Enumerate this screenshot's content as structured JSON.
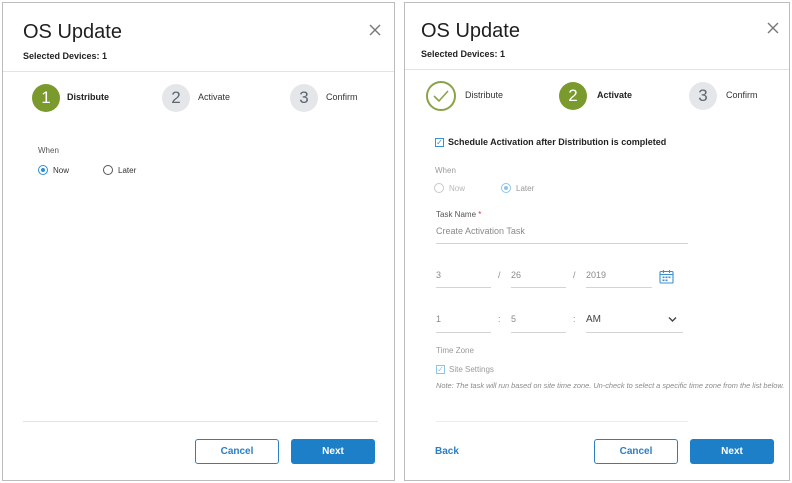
{
  "left_panel": {
    "title": "OS Update",
    "subtitle": "Selected Devices: 1",
    "steps": [
      {
        "number": "1",
        "label": "Distribute",
        "state": "active"
      },
      {
        "number": "2",
        "label": "Activate",
        "state": "inactive"
      },
      {
        "number": "3",
        "label": "Confirm",
        "state": "inactive"
      }
    ],
    "when_label": "When",
    "when_options": [
      {
        "label": "Now",
        "selected": true
      },
      {
        "label": "Later",
        "selected": false
      }
    ],
    "cancel_label": "Cancel",
    "next_label": "Next"
  },
  "right_panel": {
    "title": "OS Update",
    "subtitle": "Selected Devices: 1",
    "steps": [
      {
        "number": "",
        "label": "Distribute",
        "state": "done"
      },
      {
        "number": "2",
        "label": "Activate",
        "state": "active"
      },
      {
        "number": "3",
        "label": "Confirm",
        "state": "inactive"
      }
    ],
    "schedule_checkbox_label": "Schedule Activation after Distribution is completed",
    "schedule_checked": true,
    "when_label": "When",
    "when_options": [
      {
        "label": "Now",
        "selected": false
      },
      {
        "label": "Later",
        "selected": true
      }
    ],
    "task_name_label": "Task Name",
    "task_name_required": "*",
    "task_name_value": "Create Activation Task",
    "date": {
      "month": "3",
      "day": "26",
      "year": "2019",
      "separator": "/"
    },
    "time": {
      "hour": "1",
      "minute": "5",
      "period": "AM",
      "separator": ":"
    },
    "time_zone_label": "Time Zone",
    "site_settings_label": "Site Settings",
    "site_settings_checked": true,
    "note": "Note: The task will run based on site time zone. Un-check to select a specific time zone from the list below.",
    "back_label": "Back",
    "cancel_label": "Cancel",
    "next_label": "Next"
  },
  "icons": {
    "close": "close-icon",
    "check": "check-icon",
    "calendar": "calendar-icon",
    "chevron": "chevron-down-icon"
  },
  "colors": {
    "step_active": "#7a9a2e",
    "primary_button": "#1e7fc9",
    "link_blue": "#2b7ec4"
  }
}
